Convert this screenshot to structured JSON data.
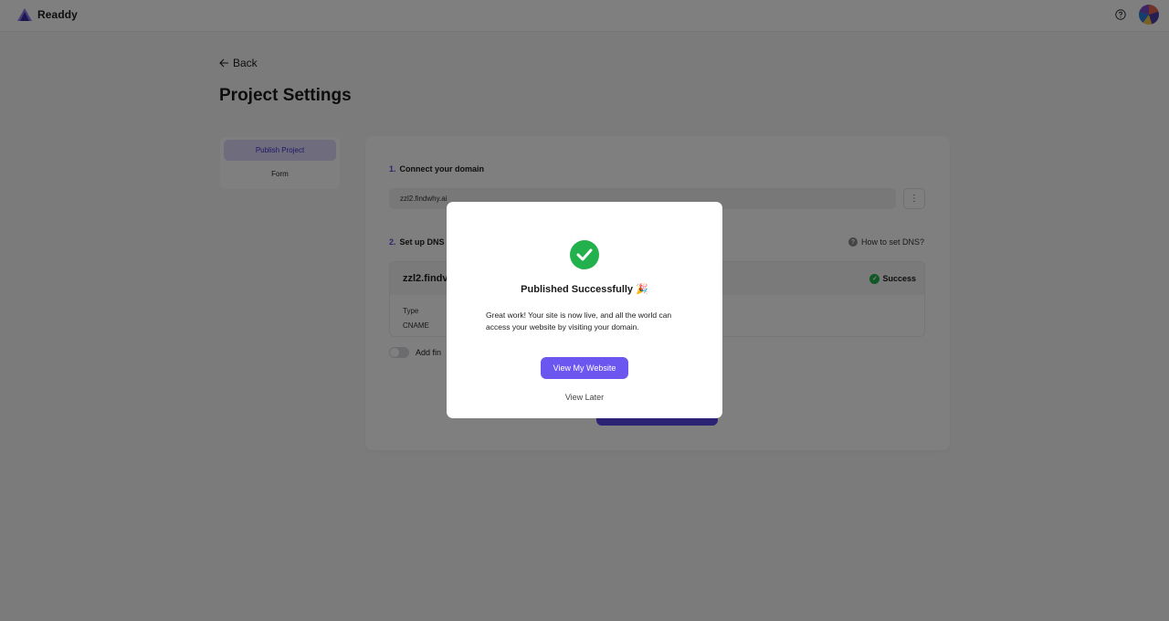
{
  "app": {
    "name": "Readdy"
  },
  "nav": {
    "back_label": "Back"
  },
  "page": {
    "title": "Project Settings"
  },
  "sidebar": {
    "items": [
      {
        "label": "Publish Project",
        "active": true
      },
      {
        "label": "Form",
        "active": false
      }
    ]
  },
  "steps": {
    "connect": {
      "number": "1.",
      "title": "Connect your domain",
      "domain_value": "zzl2.findwhy.ai"
    },
    "dns": {
      "number": "2.",
      "title": "Set up DNS",
      "help_link": "How to set DNS?",
      "domain": "zzl2.findv",
      "status": "Success",
      "type_label": "Type",
      "type_value": "CNAME"
    },
    "toggle_label": "Add fin"
  },
  "modal": {
    "title": "Published Successfully 🎉",
    "body": "Great work! Your site is now live, and all the world can access your website by visiting your domain.",
    "primary_button": "View My Website",
    "secondary_button": "View Later"
  },
  "colors": {
    "accent": "#6c56f0",
    "success": "#22b14c"
  },
  "icons": [
    "readdy-logo-icon",
    "help-icon",
    "avatar",
    "arrow-left-icon",
    "more-vertical-icon",
    "question-icon",
    "check-icon"
  ]
}
